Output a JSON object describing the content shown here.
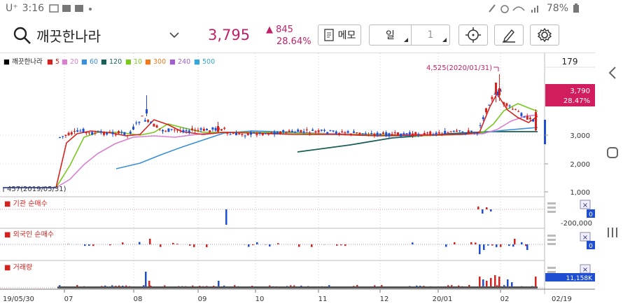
{
  "status_bar": {
    "carrier": "U⁺",
    "time": "3:16",
    "battery": "78%"
  },
  "header": {
    "stock_name": "깨끗한나라",
    "price": "3,795",
    "change_amount": "▲ 845",
    "change_percent": "28.64%",
    "memo_label": "메모",
    "period_label": "일",
    "period_count": "1"
  },
  "legend": [
    {
      "label": "■ 깨끗한나라",
      "color": "#000000"
    },
    {
      "label": "■ 5",
      "color": "#d6221f"
    },
    {
      "label": "■ 20",
      "color": "#d97fd0"
    },
    {
      "label": "■ 60",
      "color": "#3a8fd8"
    },
    {
      "label": "■ 120",
      "color": "#1a5f58"
    },
    {
      "label": "■ 10",
      "color": "#79c81d"
    },
    {
      "label": "■ 300",
      "color": "#f07a1a"
    },
    {
      "label": "■ 240",
      "color": "#a25ec9"
    },
    {
      "label": "■ 500",
      "color": "#35a7d8"
    }
  ],
  "chart_data": {
    "type": "candlestick",
    "x_ticks": [
      "19/05/30",
      "07",
      "08",
      "09",
      "10",
      "11",
      "12",
      "20/01",
      "02",
      "02/19"
    ],
    "y_ticks": [
      "1,000",
      "2,000",
      "3,000"
    ],
    "top_value": "179",
    "current_price_label": "3,790",
    "current_change_label": "28.47%",
    "high_annotation": "4,525(2020/01/31)",
    "low_annotation": "457(2019/05/31)",
    "panels": [
      {
        "title": "■ 기관 순매수",
        "right_label": "0",
        "axis_label": "-200,000"
      },
      {
        "title": "■ 외국인 순매수",
        "right_label": "0"
      },
      {
        "title": "■ 거래량",
        "right_label": "11,158K"
      }
    ]
  },
  "colors": {
    "up": "#d6221f",
    "down": "#1f4fd0",
    "accent": "#c0226a"
  }
}
